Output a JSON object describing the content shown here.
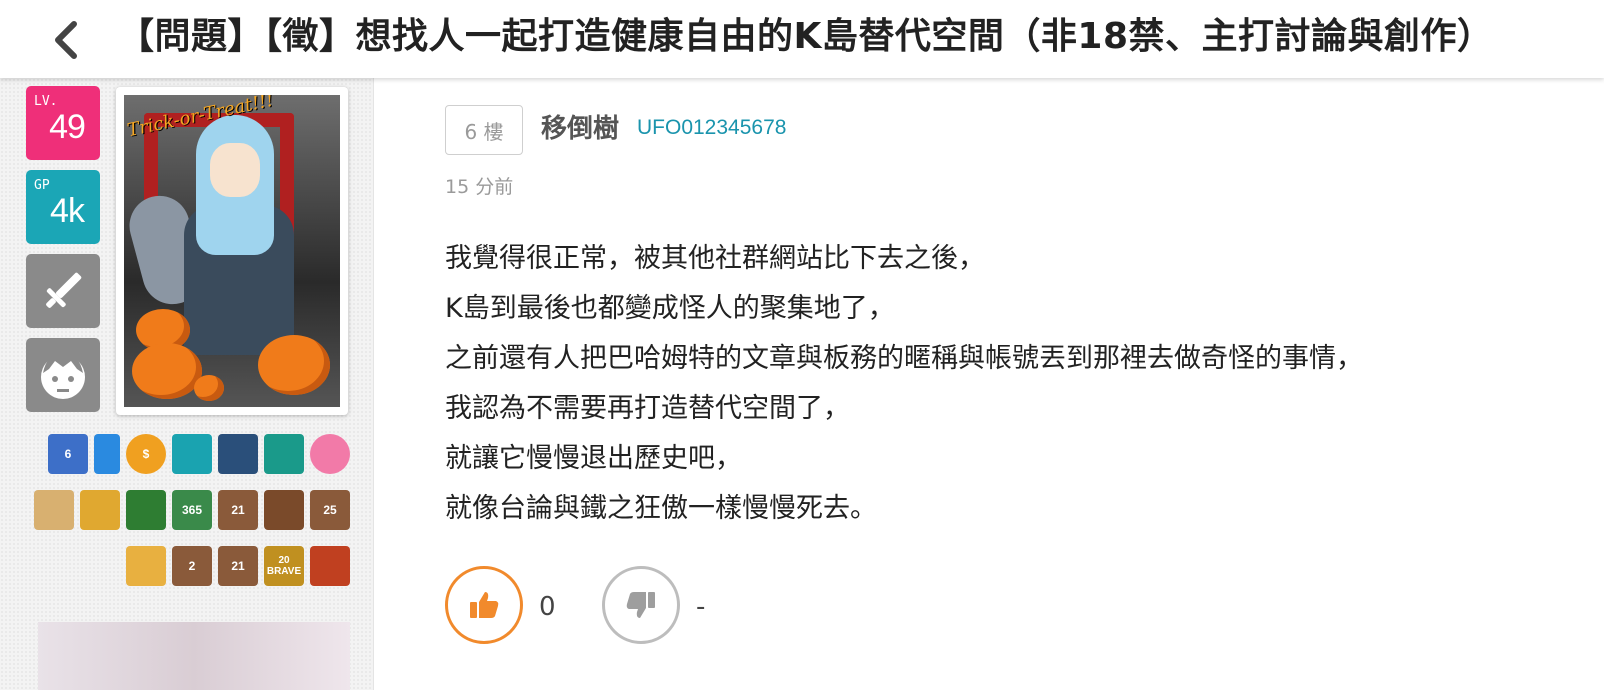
{
  "header": {
    "back_icon": "chevron-left-icon",
    "title": "【問題】【徵】想找人一起打造健康自由的K島替代空間（非18禁、主打討論與創作）"
  },
  "sidebar": {
    "level_caption": "LV.",
    "level_value": "49",
    "gp_caption": "GP",
    "gp_value": "4k",
    "weapon_icon": "sword-icon",
    "face_icon": "face-icon",
    "avatar_text": "Trick-or-Treat!!!",
    "badge_rows": [
      [
        "6",
        "",
        "$",
        "",
        "",
        "",
        ""
      ],
      [
        "",
        "",
        "",
        "365",
        "21",
        "",
        "25"
      ],
      [
        "",
        "2",
        "21",
        "20 BRAVE",
        ""
      ]
    ]
  },
  "post": {
    "floor": "6 樓",
    "author": "移倒樹",
    "user_id": "UFO012345678",
    "time": "15 分前",
    "content": [
      "我覺得很正常，被其他社群網站比下去之後，",
      "K島到最後也都變成怪人的聚集地了，",
      "之前還有人把巴哈姆特的文章與板務的暱稱與帳號丟到那裡去做奇怪的事情，",
      "我認為不需要再打造替代空間了，",
      "就讓它慢慢退出歷史吧，",
      "就像台論與鐵之狂傲一樣慢慢死去。"
    ],
    "like_count": "0",
    "dislike_count": "-"
  },
  "colors": {
    "level": "#ef2f79",
    "gp": "#1ba6b6",
    "like": "#f18a2c",
    "user_id": "#1a94ad"
  }
}
